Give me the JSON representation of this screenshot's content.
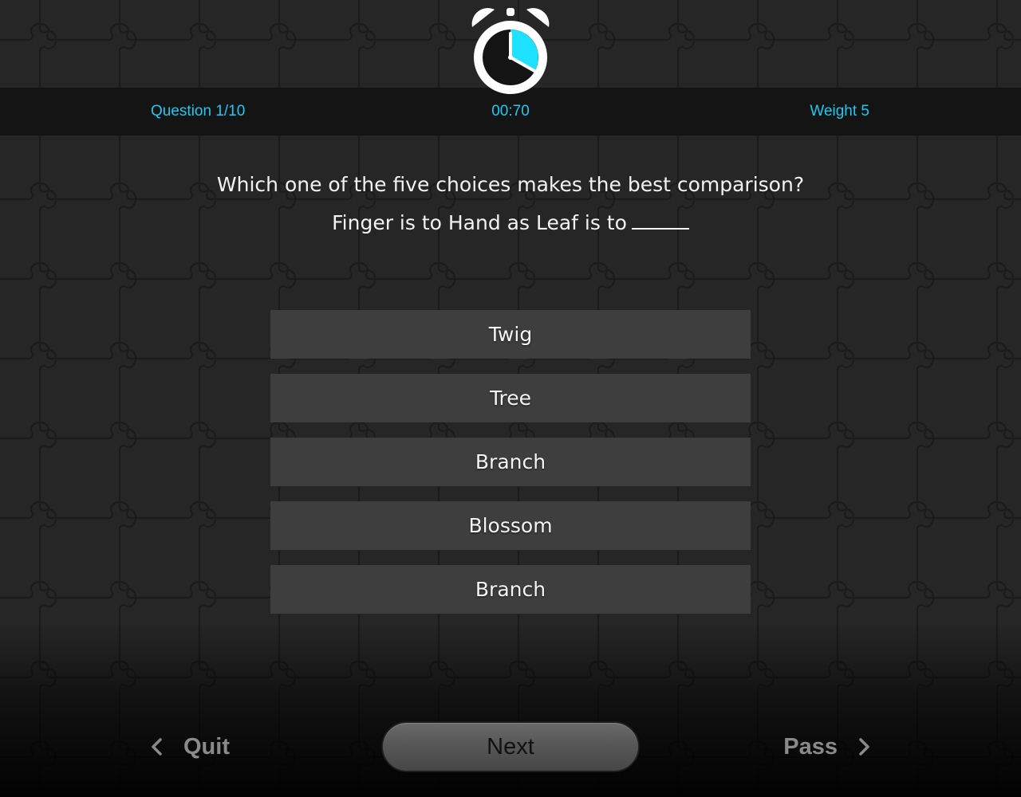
{
  "status": {
    "question_label": "Question 1/10",
    "timer": "00:70",
    "weight_label": "Weight 5"
  },
  "clock": {
    "icon": "alarm-clock-icon",
    "fill_color": "#1ee0ff"
  },
  "question": {
    "prompt": "Which one of the five choices makes the best comparison?",
    "analogy": "Finger is to Hand as Leaf is to"
  },
  "choices": [
    {
      "label": "Twig"
    },
    {
      "label": "Tree"
    },
    {
      "label": "Branch"
    },
    {
      "label": "Blossom"
    },
    {
      "label": "Branch"
    }
  ],
  "navigation": {
    "quit_label": "Quit",
    "next_label": "Next",
    "pass_label": "Pass",
    "quit_icon": "chevron-left-icon",
    "pass_icon": "chevron-right-icon"
  },
  "colors": {
    "accent": "#1ec8f0",
    "background": "#262626",
    "choice_background": "#3e3e3e"
  }
}
